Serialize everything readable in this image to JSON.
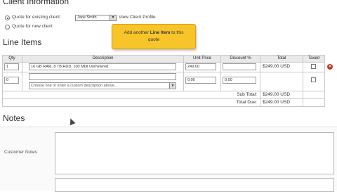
{
  "client_info": {
    "title": "Client Information",
    "existing_label": "Quote for existing client:",
    "selected_client": "Jane Smith",
    "view_profile_link": "View Client Profile",
    "new_label": "Quote for new client"
  },
  "line_items": {
    "title": "Line Items",
    "columns": [
      "Qty",
      "Description",
      "Unit Price",
      "Discount %",
      "Total",
      "Taxed"
    ],
    "rows": [
      {
        "qty": "1",
        "description": "16 GB RAM, 8 TB HDD, 100 Mbit Unmetered",
        "unit_price": "249.00",
        "discount": "",
        "total": "$249.00 USD"
      },
      {
        "qty": "0",
        "description_placeholder": "Choose one or enter a custom description above...",
        "unit_price": "0.00",
        "discount": "0.00",
        "total": ""
      }
    ],
    "subtotal_label": "Sub Total:",
    "subtotal_value": "$249.00 USD",
    "total_due_label": "Total Due:",
    "total_due_value": "$249.00 USD"
  },
  "tooltip": {
    "prefix": "Add another ",
    "bold": "Line Item",
    "suffix": " to this",
    "line2": "quote"
  },
  "notes": {
    "title": "Notes",
    "customer_notes_label": "Customer Notes"
  },
  "colors": {
    "tooltip_bg": "#f7c42a",
    "header_bg": "#e9e9e9",
    "delete_red": "#c0392b"
  }
}
